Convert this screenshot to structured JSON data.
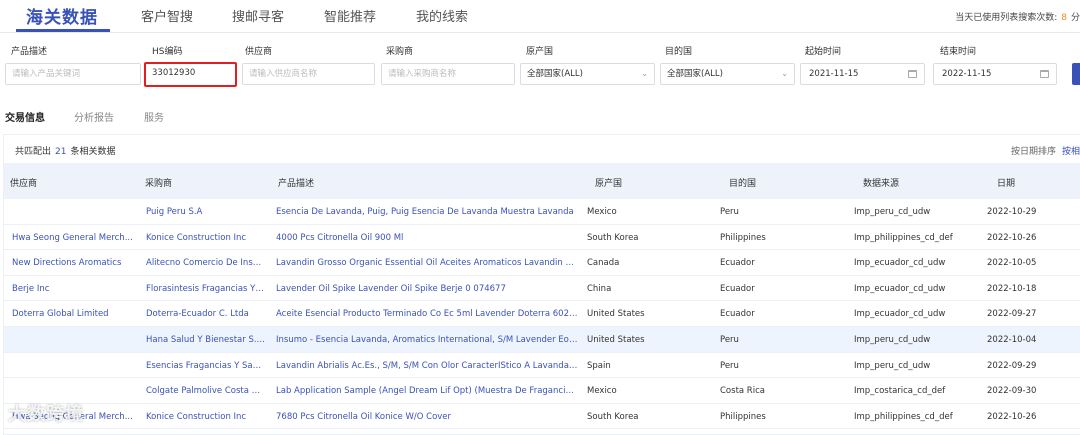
{
  "nav": {
    "items": [
      "海关数据",
      "客户智搜",
      "搜邮寻客",
      "智能推荐",
      "我的线索"
    ],
    "usage_label": "当天已使用列表搜索次数:",
    "usage_count": "8",
    "usage_suffix": "分"
  },
  "filters": {
    "product": {
      "label": "产品描述",
      "placeholder": "请输入产品关键词"
    },
    "hs": {
      "label": "HS编码",
      "value": "33012930"
    },
    "supplier": {
      "label": "供应商",
      "placeholder": "请输入供应商名称"
    },
    "buyer": {
      "label": "采购商",
      "placeholder": "请输入采购商名称"
    },
    "origin": {
      "label": "原产国",
      "value": "全部国家(ALL)"
    },
    "destination": {
      "label": "目的国",
      "value": "全部国家(ALL)"
    },
    "start": {
      "label": "起始时间",
      "value": "2021-11-15"
    },
    "end": {
      "label": "结束时间",
      "value": "2022-11-15"
    }
  },
  "subtabs": [
    "交易信息",
    "分析报告",
    "服务"
  ],
  "results": {
    "prefix": "共匹配出",
    "count": "21",
    "suffix": "条相关数据",
    "sort_by_date": "按日期排序",
    "sort_other": "按相"
  },
  "table": {
    "headers": [
      "供应商",
      "采购商",
      "产品描述",
      "原产国",
      "目的国",
      "数据来源",
      "日期"
    ],
    "rows": [
      {
        "supplier": "",
        "buyer": "Puig Peru S.A",
        "product": "Esencia De Lavanda, Puig, Puig Esencia De Lavanda Muestra Lavanda",
        "origin": "Mexico",
        "dest": "Peru",
        "source": "Imp_peru_cd_udw",
        "date": "2022-10-29"
      },
      {
        "supplier": "Hwa Seong General Merch...",
        "buyer": "Konice Construction Inc",
        "product": "4000 Pcs Citronella Oil 900 Ml",
        "origin": "South Korea",
        "dest": "Philippines",
        "source": "Imp_philippines_cd_def",
        "date": "2022-10-26"
      },
      {
        "supplier": "New Directions Aromatics",
        "buyer": "Alitecno Comercio De Insu...",
        "product": "Lavandin Grosso Organic Essential Oil Aceites Aromaticos Lavandin Gr...",
        "origin": "Canada",
        "dest": "Ecuador",
        "source": "Imp_ecuador_cd_udw",
        "date": "2022-10-05"
      },
      {
        "supplier": "Berje Inc",
        "buyer": "Florasintesis Fragancias Y ...",
        "product": "Lavender Oil Spike Lavender Oil Spike Berje 0 074677",
        "origin": "China",
        "dest": "Ecuador",
        "source": "Imp_ecuador_cd_udw",
        "date": "2022-10-18"
      },
      {
        "supplier": "Doterra Global Limited",
        "buyer": "Doterra-Ecuador C. Ltda",
        "product": "Aceite Esencial Producto Terminado Co Ec 5ml Lavender Doterra 6020...",
        "origin": "United States",
        "dest": "Ecuador",
        "source": "Imp_ecuador_cd_udw",
        "date": "2022-09-27"
      },
      {
        "supplier": "",
        "buyer": "Hana Salud Y Bienestar S.A...",
        "product": "Insumo - Esencia Lavanda, Aromatics International, S/M Lavender Eo-1...",
        "origin": "United States",
        "dest": "Peru",
        "source": "Imp_peru_cd_udw",
        "date": "2022-10-04"
      },
      {
        "supplier": "",
        "buyer": "Esencias Fragancias Y Sab...",
        "product": "Lavandin Abrialis Ac.Es., S/M, S/M Con Olor CaracterÍStico A Lavandas...",
        "origin": "Spain",
        "dest": "Peru",
        "source": "Imp_peru_cd_udw",
        "date": "2022-09-29"
      },
      {
        "supplier": "",
        "buyer": "Colgate Palmolive Costa Ri...",
        "product": "Lab Application Sample (Angel Dream Lif Opt) (Muestra De Fragancia ...",
        "origin": "Mexico",
        "dest": "Costa Rica",
        "source": "Imp_costarica_cd_def",
        "date": "2022-09-30"
      },
      {
        "supplier": "Hwa Seong General Merch...",
        "buyer": "Konice Construction Inc",
        "product": "7680 Pcs Citronella Oil Konice W/O Cover",
        "origin": "South Korea",
        "dest": "Philippines",
        "source": "Imp_philippines_cd_def",
        "date": "2022-10-26"
      }
    ]
  },
  "watermark": "大数跨境",
  "colors": {
    "accent": "#3a52b8",
    "highlight_border": "#e02020",
    "usage_count": "#f08a24"
  }
}
